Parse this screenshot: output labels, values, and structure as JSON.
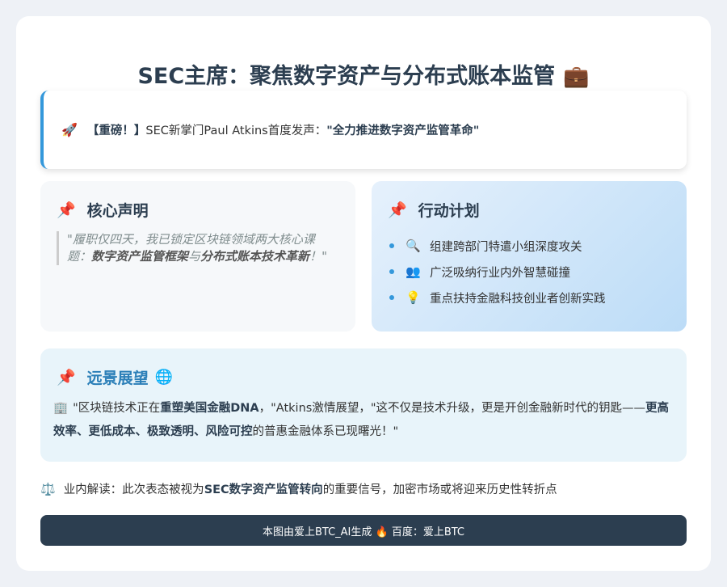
{
  "title": {
    "text": "SEC主席：聚焦数字资产与分布式账本监管",
    "emoji": "💼"
  },
  "banner": {
    "icon": "🚀",
    "tag": "【重磅！】",
    "text": "SEC新掌门Paul Atkins首度发声：",
    "highlight": "\"全力推进数字资产监管革命\""
  },
  "declaration": {
    "icon": "📌",
    "heading": "核心声明",
    "quote_open": "\"履职仅四天，我已锁定区块链领域两大核心课题：",
    "term1": "数字资产监管框架",
    "conn": "与",
    "term2": "分布式账本技术革新",
    "quote_close": "！\""
  },
  "plan": {
    "icon": "📌",
    "heading": "行动计划",
    "items": [
      {
        "icon": "🔍",
        "text": "组建跨部门特遣小组深度攻关"
      },
      {
        "icon": "👥",
        "text": "广泛吸纳行业内外智慧碰撞"
      },
      {
        "icon": "💡",
        "text": "重点扶持金融科技创业者创新实践"
      }
    ]
  },
  "vision": {
    "icon": "📌",
    "heading": "远景展望",
    "globe": "🌐",
    "building": "🏢",
    "p1": "\"区块链技术正在",
    "b1": "重塑美国金融DNA",
    "p2": "，\"Atkins激情展望，\"这不仅是技术升级，更是开创金融新时代的钥匙——",
    "b2": "更高效率、更低成本、极致透明、风险可控",
    "p3": "的普惠金融体系已现曙光！\""
  },
  "insight": {
    "icon": "⚖️",
    "prefix": "业内解读：此次表态被视为",
    "bold": "SEC数字资产监管转向",
    "suffix": "的重要信号，加密市场或将迎来历史性转折点"
  },
  "footer": {
    "text": "本图由爱上BTC_AI生成 🔥 百度：爱上BTC"
  }
}
